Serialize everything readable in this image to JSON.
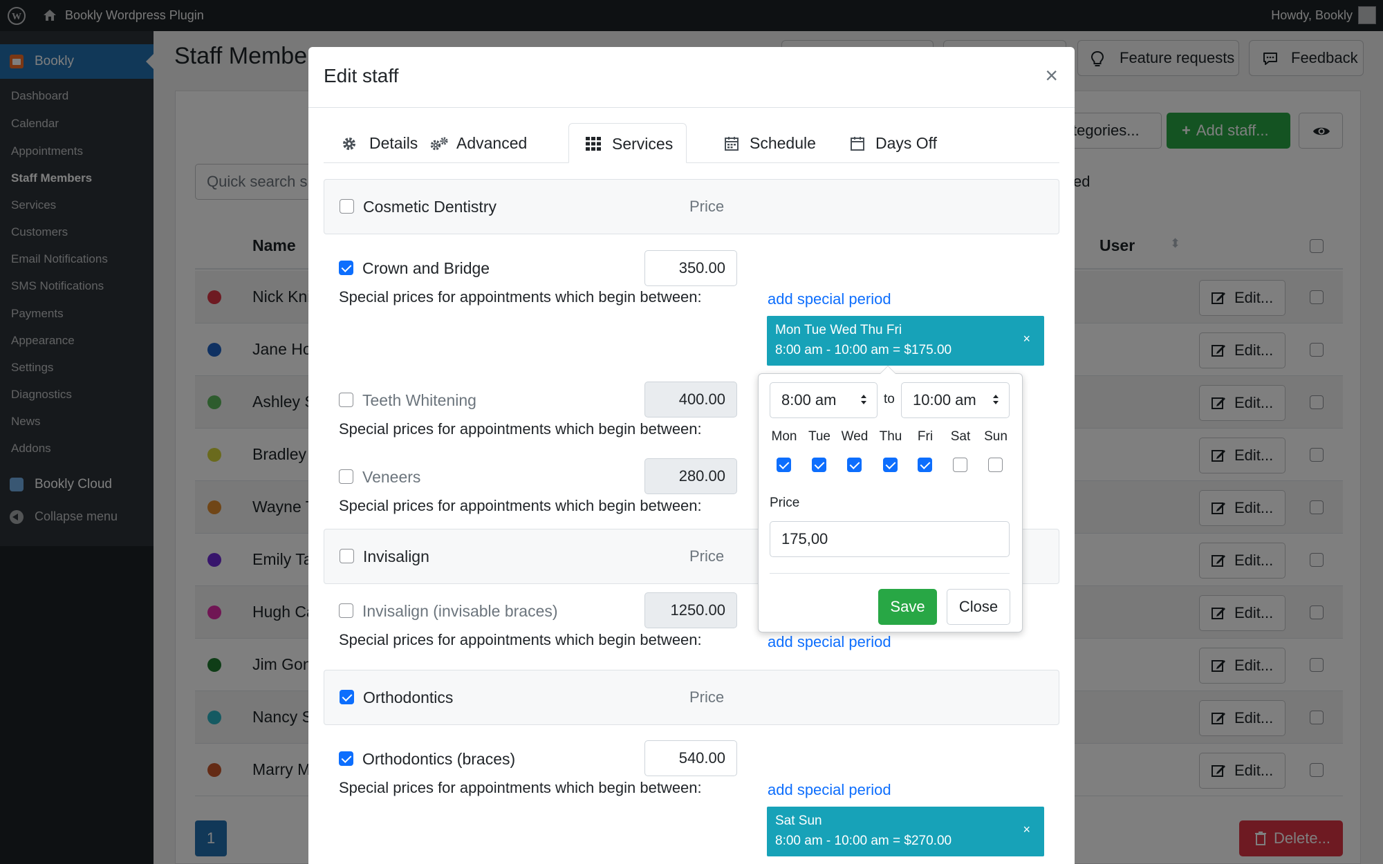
{
  "adminbar": {
    "site_name": "Bookly Wordpress Plugin",
    "howdy": "Howdy, Bookly"
  },
  "sidebar": {
    "plugin": "Bookly",
    "items": [
      "Dashboard",
      "Calendar",
      "Appointments",
      "Staff Members",
      "Services",
      "Customers",
      "Email Notifications",
      "SMS Notifications",
      "Payments",
      "Appearance",
      "Settings",
      "Diagnostics",
      "News",
      "Addons"
    ],
    "current": "Staff Members",
    "cloud": "Bookly Cloud",
    "collapse": "Collapse menu"
  },
  "page": {
    "title": "Staff Membe",
    "feature_requests": "Feature requests",
    "feedback": "Feedback",
    "quick_search": "Quick search s",
    "categories_btn": "tegories...",
    "add_staff_btn": "Add staff...",
    "ed_text": "ed",
    "col_name": "Name",
    "col_user": "User",
    "edit_label": "Edit...",
    "page_number": "1",
    "delete_btn": "Delete...",
    "staff": [
      {
        "name": "Nick Kni",
        "color": "#dc3545"
      },
      {
        "name": "Jane Ho",
        "color": "#1e63c4"
      },
      {
        "name": "Ashley S",
        "color": "#5cb85c"
      },
      {
        "name": "Bradley",
        "color": "#d4d43a"
      },
      {
        "name": "Wayne T",
        "color": "#e08c2e"
      },
      {
        "name": "Emily Ta",
        "color": "#6f2ad8"
      },
      {
        "name": "Hugh Ca",
        "color": "#e02ca8"
      },
      {
        "name": "Jim Gon",
        "color": "#1f7a2e"
      },
      {
        "name": "Nancy S",
        "color": "#2bb5c4"
      },
      {
        "name": "Marry M",
        "color": "#c9562a"
      }
    ]
  },
  "modal": {
    "title": "Edit staff",
    "close": "×",
    "tabs": [
      "Details",
      "Advanced",
      "Services",
      "Schedule",
      "Days Off"
    ],
    "active_tab": "Services",
    "price_label": "Price",
    "special_text": "Special prices for appointments which begin between:",
    "add_special": "add special period",
    "categories": [
      {
        "name": "Cosmetic Dentistry",
        "checked": false
      },
      {
        "name": "Invisalign",
        "checked": false
      },
      {
        "name": "Orthodontics",
        "checked": true
      }
    ],
    "services": [
      {
        "name": "Crown and Bridge",
        "price": "350.00",
        "checked": true
      },
      {
        "name": "Teeth Whitening",
        "price": "400.00",
        "checked": false
      },
      {
        "name": "Veneers",
        "price": "280.00",
        "checked": false
      },
      {
        "name": "Invisalign (invisable braces)",
        "price": "1250.00",
        "checked": false
      },
      {
        "name": "Orthodontics (braces)",
        "price": "540.00",
        "checked": true
      }
    ],
    "periods": [
      {
        "days": "Mon Tue Wed Thu Fri",
        "range": "8:00 am - 10:00 am = $175.00"
      },
      {
        "days": "Sat Sun",
        "range": "8:00 am - 10:00 am = $270.00"
      }
    ],
    "period_remove": "×"
  },
  "popover": {
    "from": "8:00 am",
    "to_label": "to",
    "to": "10:00 am",
    "days": [
      "Mon",
      "Tue",
      "Wed",
      "Thu",
      "Fri",
      "Sat",
      "Sun"
    ],
    "days_checked": [
      true,
      true,
      true,
      true,
      true,
      false,
      false
    ],
    "price_label": "Price",
    "price_value": "175,00",
    "save": "Save",
    "close": "Close"
  },
  "colors": {
    "wp_dark": "#1d2327",
    "wp_blue": "#2271b1",
    "primary": "#0d6efd",
    "success": "#28a745",
    "info": "#17a2b8",
    "danger": "#dc3545"
  }
}
